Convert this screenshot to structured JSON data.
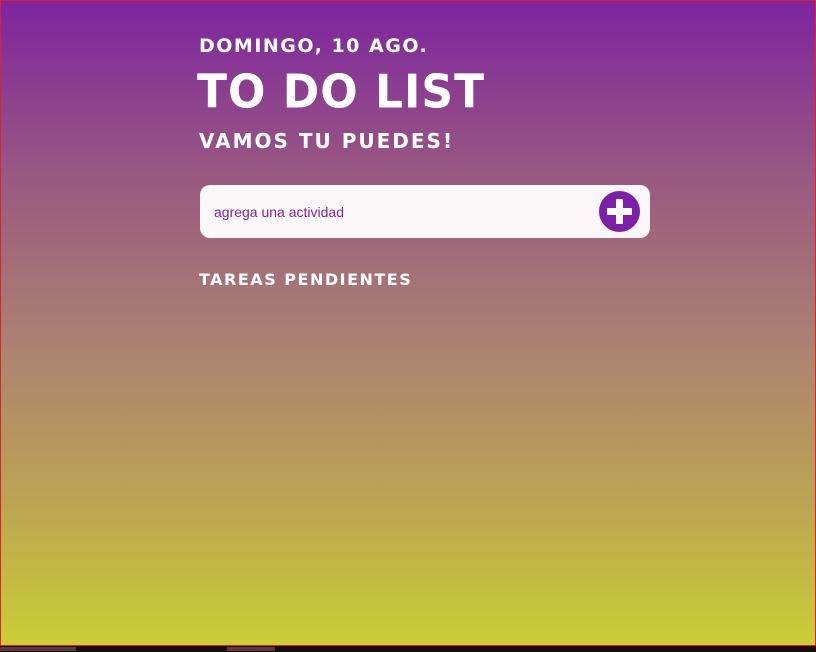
{
  "header": {
    "date": "Domingo, 10 ago.",
    "title": "To Do List",
    "subtitle": "Vamos tu puedes!"
  },
  "add_task": {
    "placeholder": "agrega una actividad",
    "button_icon": "plus-icon"
  },
  "pending": {
    "heading": "Tareas pendientes",
    "items": []
  },
  "colors": {
    "gradient_top": "#7d24a0",
    "gradient_bottom": "#cace35",
    "accent": "#7d1fa8",
    "text": "#ffffff"
  }
}
